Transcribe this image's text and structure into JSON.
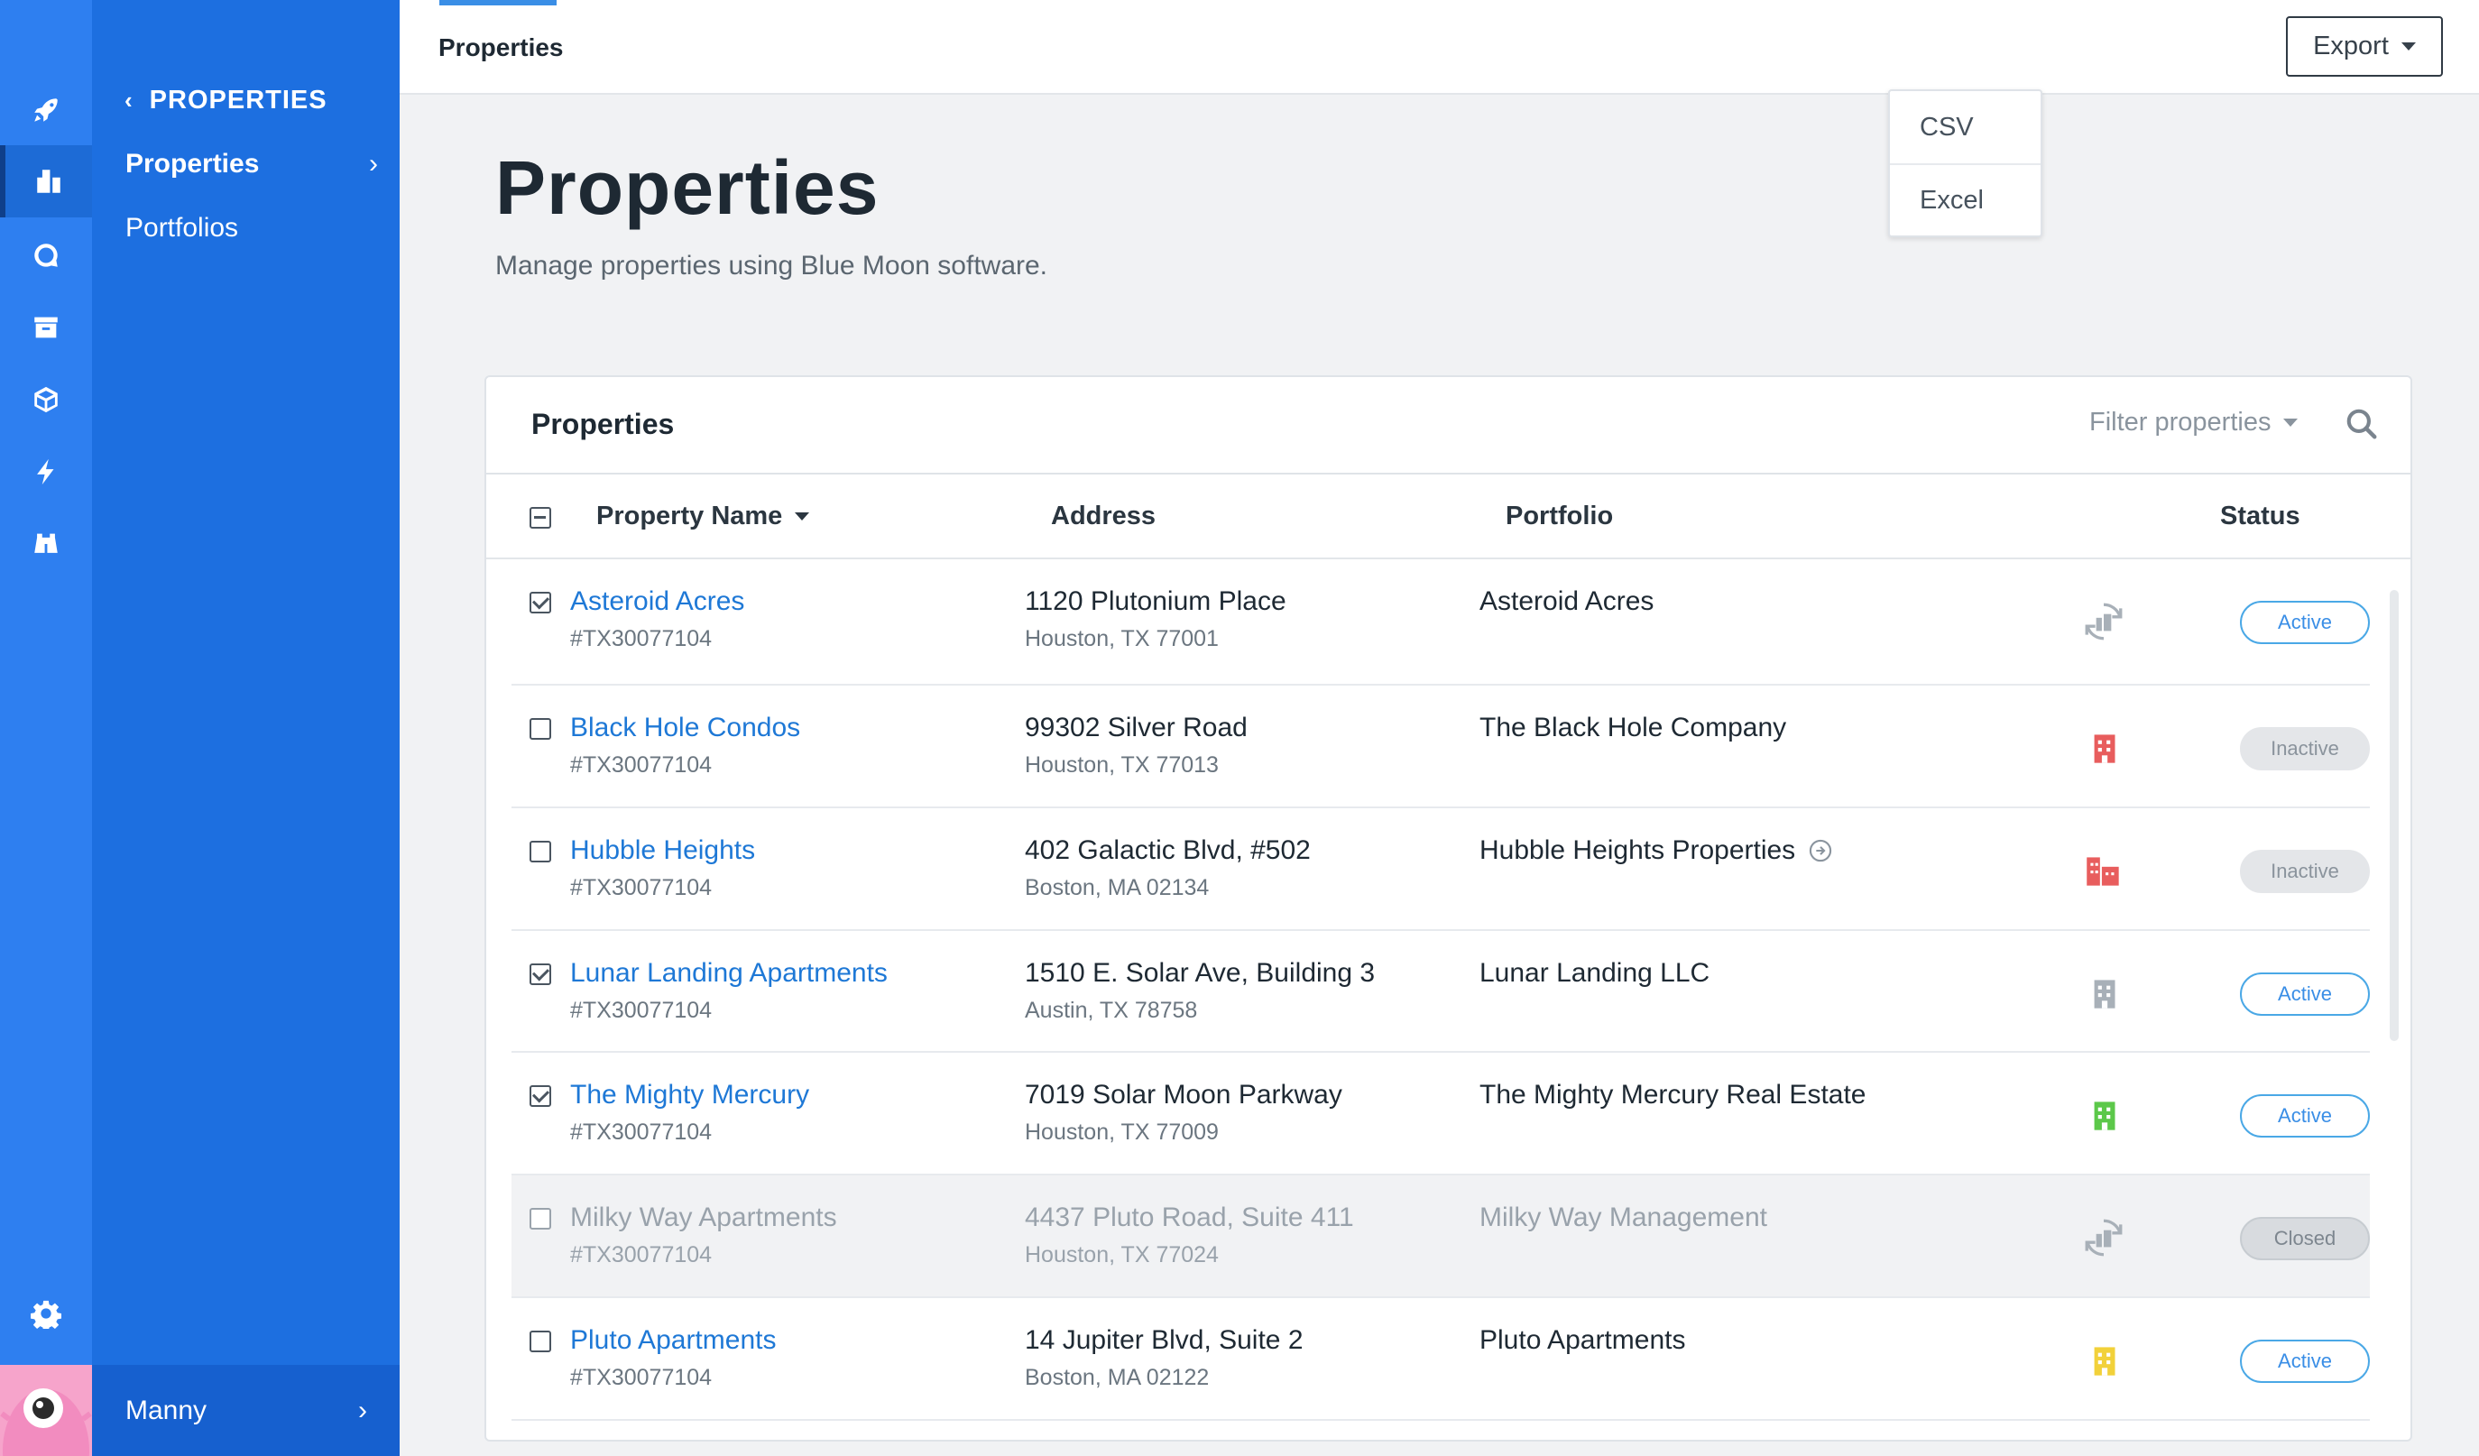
{
  "sidebar": {
    "back_label": "PROPERTIES",
    "items": [
      {
        "label": "Properties",
        "active": true
      },
      {
        "label": "Portfolios",
        "active": false
      }
    ],
    "user_name": "Manny",
    "rail_icons": [
      "rocket-icon",
      "buildings-icon",
      "chat-bubble-icon",
      "archive-icon",
      "cube-icon",
      "lightning-icon",
      "binoculars-icon",
      "gear-icon"
    ]
  },
  "topbar": {
    "tab_label": "Properties",
    "export_label": "Export",
    "export_options": [
      "CSV",
      "Excel"
    ]
  },
  "header": {
    "title": "Properties",
    "subtitle": "Manage properties using Blue Moon software."
  },
  "card": {
    "title": "Properties",
    "filter_placeholder": "Filter properties"
  },
  "table": {
    "columns": [
      "Property Name",
      "Address",
      "Portfolio",
      "Status"
    ],
    "rows": [
      {
        "name": "Asteroid Acres",
        "id": "#TX30077104",
        "address": "1120 Plutonium Place",
        "city": "Houston, TX 77001",
        "portfolio": "Asteroid Acres",
        "status": "Active",
        "checked": true,
        "icon": "sync-building-icon",
        "icon_color": "#a8b0b8"
      },
      {
        "name": "Black Hole Condos",
        "id": "#TX30077104",
        "address": "99302 Silver Road",
        "city": "Houston, TX 77013",
        "portfolio": "The Black Hole Company",
        "status": "Inactive",
        "checked": false,
        "icon": "building-icon",
        "icon_color": "#e85d5d"
      },
      {
        "name": "Hubble Heights",
        "id": "#TX30077104",
        "address": "402 Galactic Blvd, #502",
        "city": "Boston, MA 02134",
        "portfolio": "Hubble Heights Properties",
        "status": "Inactive",
        "checked": false,
        "icon": "buildings-icon",
        "icon_color": "#e85d5d",
        "portfolio_link": true
      },
      {
        "name": "Lunar Landing Apartments",
        "id": "#TX30077104",
        "address": "1510 E. Solar Ave, Building 3",
        "city": "Austin, TX 78758",
        "portfolio": "Lunar Landing LLC",
        "status": "Active",
        "checked": true,
        "icon": "building-icon",
        "icon_color": "#a8b0b8"
      },
      {
        "name": "The Mighty Mercury",
        "id": "#TX30077104",
        "address": "7019 Solar Moon Parkway",
        "city": "Houston, TX 77009",
        "portfolio": "The Mighty Mercury Real Estate",
        "status": "Active",
        "checked": true,
        "icon": "building-icon",
        "icon_color": "#5cc84a"
      },
      {
        "name": "Milky Way Apartments",
        "id": "#TX30077104",
        "address": "4437 Pluto Road, Suite 411",
        "city": "Houston, TX 77024",
        "portfolio": "Milky Way Management",
        "status": "Closed",
        "checked": false,
        "icon": "sync-building-icon",
        "icon_color": "#a8b0b8",
        "muted": true
      },
      {
        "name": "Pluto Apartments",
        "id": "#TX30077104",
        "address": "14 Jupiter Blvd, Suite 2",
        "city": "Boston, MA 02122",
        "portfolio": "Pluto Apartments",
        "status": "Active",
        "checked": false,
        "icon": "building-icon",
        "icon_color": "#f2d13a"
      }
    ]
  },
  "colors": {
    "rail": "#2e7ff0",
    "submenu": "#1d6fe0",
    "link": "#1e78d6",
    "active_badge": "#3a8ee6"
  }
}
